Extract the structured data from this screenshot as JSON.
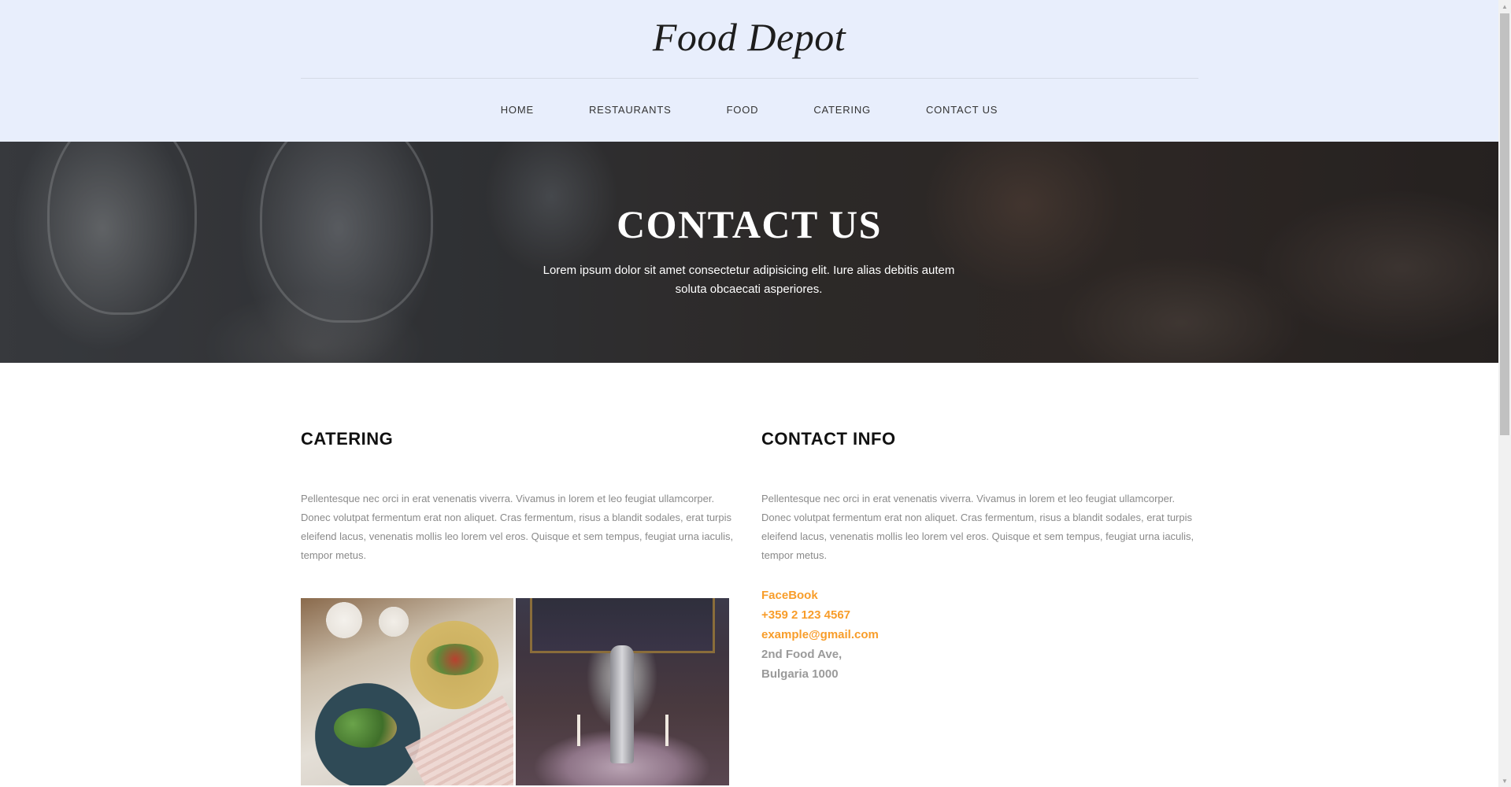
{
  "header": {
    "brand": "Food Depot",
    "nav": [
      {
        "label": "HOME"
      },
      {
        "label": "RESTAURANTS"
      },
      {
        "label": "FOOD"
      },
      {
        "label": "CATERING"
      },
      {
        "label": "CONTACT US"
      }
    ]
  },
  "hero": {
    "title": "CONTACT US",
    "text": "Lorem ipsum dolor sit amet consectetur adipisicing elit. Iure alias debitis autem soluta obcaecati asperiores."
  },
  "catering": {
    "title": "CATERING",
    "text": "Pellentesque nec orci in erat venenatis viverra. Vivamus in lorem et leo feugiat ullamcorper. Donec volutpat fermentum erat non aliquet. Cras fermentum, risus a blandit sodales, erat turpis eleifend lacus, venenatis mollis leo lorem vel eros. Quisque et sem tempus, feugiat urna iaculis, tempor metus."
  },
  "contact_info": {
    "title": "CONTACT INFO",
    "text": "Pellentesque nec orci in erat venenatis viverra. Vivamus in lorem et leo feugiat ullamcorper. Donec volutpat fermentum erat non aliquet. Cras fermentum, risus a blandit sodales, erat turpis eleifend lacus, venenatis mollis leo lorem vel eros. Quisque et sem tempus, feugiat urna iaculis, tempor metus.",
    "facebook": "FaceBook",
    "phone": "+359 2 123 4567",
    "email": "example@gmail.com",
    "address_line1": "2nd Food Ave,",
    "address_line2": "Bulgaria 1000"
  },
  "colors": {
    "header_bg": "#e8eefc",
    "link_accent": "#f89d2a",
    "body_text": "#8a8a8a"
  }
}
